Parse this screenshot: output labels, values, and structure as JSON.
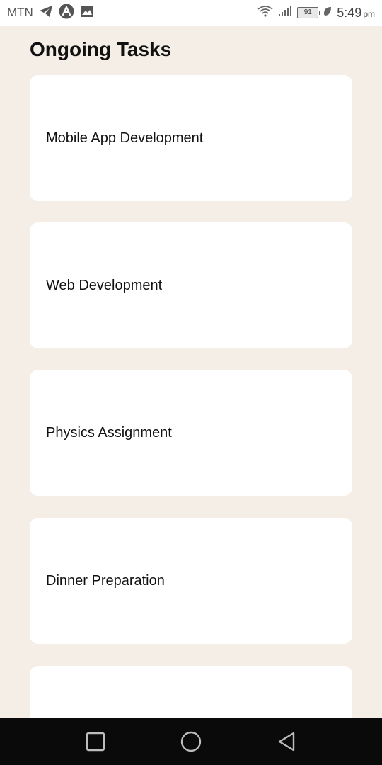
{
  "status_bar": {
    "carrier": "MTN",
    "battery_level": "91",
    "time": "5:49",
    "ampm": "pm",
    "icons": [
      "telegram-icon",
      "app-a-icon",
      "image-icon",
      "wifi-icon",
      "signal-icon",
      "battery-icon",
      "leaf-icon"
    ]
  },
  "page": {
    "title": "Ongoing Tasks"
  },
  "tasks": [
    {
      "label": "Mobile App Development"
    },
    {
      "label": "Web Development"
    },
    {
      "label": "Physics Assignment"
    },
    {
      "label": "Dinner Preparation"
    },
    {
      "label": ""
    }
  ],
  "navigation_bar": {
    "buttons": [
      "recent-apps",
      "home",
      "back"
    ]
  },
  "colors": {
    "page_background": "#f5eee7",
    "card_background": "#ffffff",
    "nav_bar": "#0a0a0a",
    "text": "#111111"
  }
}
